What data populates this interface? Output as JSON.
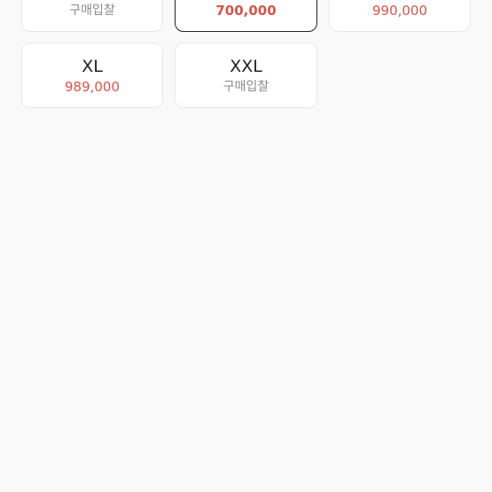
{
  "sizes": [
    {
      "label": "",
      "price": "구매입찰",
      "is_bid": true,
      "selected": false
    },
    {
      "label": "",
      "price": "700,000",
      "is_bid": false,
      "selected": true
    },
    {
      "label": "",
      "price": "990,000",
      "is_bid": false,
      "selected": false
    },
    {
      "label": "XL",
      "price": "989,000",
      "is_bid": false,
      "selected": false
    },
    {
      "label": "XXL",
      "price": "구매입찰",
      "is_bid": true,
      "selected": false
    }
  ],
  "colors": {
    "price": "#d4554a",
    "bid": "#8a8a8a",
    "selected_border": "#222222"
  }
}
